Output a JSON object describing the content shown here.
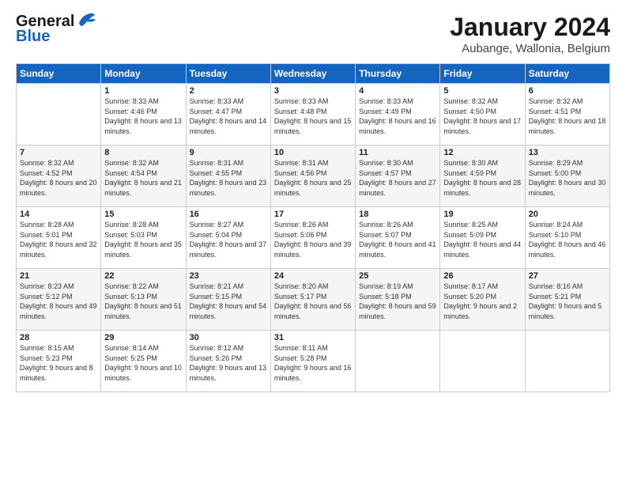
{
  "logo": {
    "line1": "General",
    "line2": "Blue"
  },
  "title": "January 2024",
  "subtitle": "Aubange, Wallonia, Belgium",
  "headers": [
    "Sunday",
    "Monday",
    "Tuesday",
    "Wednesday",
    "Thursday",
    "Friday",
    "Saturday"
  ],
  "weeks": [
    [
      {
        "day": "",
        "sunrise": "",
        "sunset": "",
        "daylight": ""
      },
      {
        "day": "1",
        "sunrise": "Sunrise: 8:33 AM",
        "sunset": "Sunset: 4:46 PM",
        "daylight": "Daylight: 8 hours and 13 minutes."
      },
      {
        "day": "2",
        "sunrise": "Sunrise: 8:33 AM",
        "sunset": "Sunset: 4:47 PM",
        "daylight": "Daylight: 8 hours and 14 minutes."
      },
      {
        "day": "3",
        "sunrise": "Sunrise: 8:33 AM",
        "sunset": "Sunset: 4:48 PM",
        "daylight": "Daylight: 8 hours and 15 minutes."
      },
      {
        "day": "4",
        "sunrise": "Sunrise: 8:33 AM",
        "sunset": "Sunset: 4:49 PM",
        "daylight": "Daylight: 8 hours and 16 minutes."
      },
      {
        "day": "5",
        "sunrise": "Sunrise: 8:32 AM",
        "sunset": "Sunset: 4:50 PM",
        "daylight": "Daylight: 8 hours and 17 minutes."
      },
      {
        "day": "6",
        "sunrise": "Sunrise: 8:32 AM",
        "sunset": "Sunset: 4:51 PM",
        "daylight": "Daylight: 8 hours and 18 minutes."
      }
    ],
    [
      {
        "day": "7",
        "sunrise": "Sunrise: 8:32 AM",
        "sunset": "Sunset: 4:52 PM",
        "daylight": "Daylight: 8 hours and 20 minutes."
      },
      {
        "day": "8",
        "sunrise": "Sunrise: 8:32 AM",
        "sunset": "Sunset: 4:54 PM",
        "daylight": "Daylight: 8 hours and 21 minutes."
      },
      {
        "day": "9",
        "sunrise": "Sunrise: 8:31 AM",
        "sunset": "Sunset: 4:55 PM",
        "daylight": "Daylight: 8 hours and 23 minutes."
      },
      {
        "day": "10",
        "sunrise": "Sunrise: 8:31 AM",
        "sunset": "Sunset: 4:56 PM",
        "daylight": "Daylight: 8 hours and 25 minutes."
      },
      {
        "day": "11",
        "sunrise": "Sunrise: 8:30 AM",
        "sunset": "Sunset: 4:57 PM",
        "daylight": "Daylight: 8 hours and 27 minutes."
      },
      {
        "day": "12",
        "sunrise": "Sunrise: 8:30 AM",
        "sunset": "Sunset: 4:59 PM",
        "daylight": "Daylight: 8 hours and 28 minutes."
      },
      {
        "day": "13",
        "sunrise": "Sunrise: 8:29 AM",
        "sunset": "Sunset: 5:00 PM",
        "daylight": "Daylight: 8 hours and 30 minutes."
      }
    ],
    [
      {
        "day": "14",
        "sunrise": "Sunrise: 8:28 AM",
        "sunset": "Sunset: 5:01 PM",
        "daylight": "Daylight: 8 hours and 32 minutes."
      },
      {
        "day": "15",
        "sunrise": "Sunrise: 8:28 AM",
        "sunset": "Sunset: 5:03 PM",
        "daylight": "Daylight: 8 hours and 35 minutes."
      },
      {
        "day": "16",
        "sunrise": "Sunrise: 8:27 AM",
        "sunset": "Sunset: 5:04 PM",
        "daylight": "Daylight: 8 hours and 37 minutes."
      },
      {
        "day": "17",
        "sunrise": "Sunrise: 8:26 AM",
        "sunset": "Sunset: 5:06 PM",
        "daylight": "Daylight: 8 hours and 39 minutes."
      },
      {
        "day": "18",
        "sunrise": "Sunrise: 8:26 AM",
        "sunset": "Sunset: 5:07 PM",
        "daylight": "Daylight: 8 hours and 41 minutes."
      },
      {
        "day": "19",
        "sunrise": "Sunrise: 8:25 AM",
        "sunset": "Sunset: 5:09 PM",
        "daylight": "Daylight: 8 hours and 44 minutes."
      },
      {
        "day": "20",
        "sunrise": "Sunrise: 8:24 AM",
        "sunset": "Sunset: 5:10 PM",
        "daylight": "Daylight: 8 hours and 46 minutes."
      }
    ],
    [
      {
        "day": "21",
        "sunrise": "Sunrise: 8:23 AM",
        "sunset": "Sunset: 5:12 PM",
        "daylight": "Daylight: 8 hours and 49 minutes."
      },
      {
        "day": "22",
        "sunrise": "Sunrise: 8:22 AM",
        "sunset": "Sunset: 5:13 PM",
        "daylight": "Daylight: 8 hours and 51 minutes."
      },
      {
        "day": "23",
        "sunrise": "Sunrise: 8:21 AM",
        "sunset": "Sunset: 5:15 PM",
        "daylight": "Daylight: 8 hours and 54 minutes."
      },
      {
        "day": "24",
        "sunrise": "Sunrise: 8:20 AM",
        "sunset": "Sunset: 5:17 PM",
        "daylight": "Daylight: 8 hours and 56 minutes."
      },
      {
        "day": "25",
        "sunrise": "Sunrise: 8:19 AM",
        "sunset": "Sunset: 5:18 PM",
        "daylight": "Daylight: 8 hours and 59 minutes."
      },
      {
        "day": "26",
        "sunrise": "Sunrise: 8:17 AM",
        "sunset": "Sunset: 5:20 PM",
        "daylight": "Daylight: 9 hours and 2 minutes."
      },
      {
        "day": "27",
        "sunrise": "Sunrise: 8:16 AM",
        "sunset": "Sunset: 5:21 PM",
        "daylight": "Daylight: 9 hours and 5 minutes."
      }
    ],
    [
      {
        "day": "28",
        "sunrise": "Sunrise: 8:15 AM",
        "sunset": "Sunset: 5:23 PM",
        "daylight": "Daylight: 9 hours and 8 minutes."
      },
      {
        "day": "29",
        "sunrise": "Sunrise: 8:14 AM",
        "sunset": "Sunset: 5:25 PM",
        "daylight": "Daylight: 9 hours and 10 minutes."
      },
      {
        "day": "30",
        "sunrise": "Sunrise: 8:12 AM",
        "sunset": "Sunset: 5:26 PM",
        "daylight": "Daylight: 9 hours and 13 minutes."
      },
      {
        "day": "31",
        "sunrise": "Sunrise: 8:11 AM",
        "sunset": "Sunset: 5:28 PM",
        "daylight": "Daylight: 9 hours and 16 minutes."
      },
      {
        "day": "",
        "sunrise": "",
        "sunset": "",
        "daylight": ""
      },
      {
        "day": "",
        "sunrise": "",
        "sunset": "",
        "daylight": ""
      },
      {
        "day": "",
        "sunrise": "",
        "sunset": "",
        "daylight": ""
      }
    ]
  ]
}
